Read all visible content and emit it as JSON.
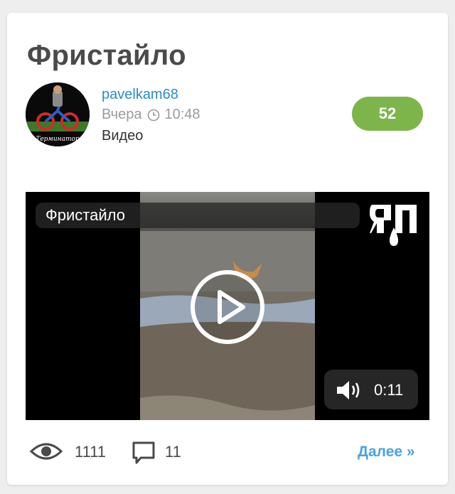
{
  "post": {
    "title": "Фристайло",
    "author": "pavelkam68",
    "date": "Вчера",
    "time": "10:48",
    "category": "Видео",
    "rating": "52",
    "avatar_caption": "Терминатор"
  },
  "video": {
    "title": "Фристайло",
    "logo_text": "ЯП",
    "duration": "0:11"
  },
  "stats": {
    "views": "1111",
    "comments": "11",
    "more_label": "Далее »"
  },
  "colors": {
    "rating_bg": "#7db54a",
    "author": "#2a8cc5",
    "more": "#4aa3df",
    "title": "#4a4a4a"
  },
  "icons": [
    "clock-icon",
    "play-icon",
    "volume-icon",
    "eye-icon",
    "comment-icon"
  ]
}
